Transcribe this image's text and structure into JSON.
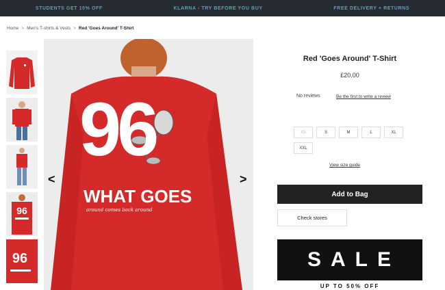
{
  "promo_bar": {
    "items": [
      "STUDENTS GET 10% OFF",
      "KLARNA - TRY BEFORE YOU BUY",
      "FREE DELIVERY + RETURNS"
    ]
  },
  "breadcrumb": {
    "home": "Home",
    "category": "Men's T-shirts & Vests",
    "current": "Red 'Goes Around' T-Shirt"
  },
  "product": {
    "title": "Red 'Goes Around' T-Shirt",
    "price": "£20.00",
    "reviews_text": "No reviews",
    "review_link": "Be the first to write a review",
    "sizes": [
      {
        "label": "XS",
        "available": false
      },
      {
        "label": "S",
        "available": true
      },
      {
        "label": "M",
        "available": true
      },
      {
        "label": "L",
        "available": true
      },
      {
        "label": "XL",
        "available": true
      },
      {
        "label": "XXL",
        "available": true
      }
    ],
    "size_guide": "View size guide",
    "add_to_bag": "Add to Bag",
    "check_stores": "Check stores"
  },
  "gallery": {
    "prev_arrow": "<",
    "next_arrow": ">",
    "shirt_number": "96",
    "shirt_text": "WHAT GOES",
    "shirt_script": "around comes back around"
  },
  "banner": {
    "title": "SALE",
    "subtitle": "UP TO 50% OFF"
  },
  "colors": {
    "promo_bg": "#262a31",
    "promo_text": "#4fa6c4",
    "shirt_red": "#d42a2a",
    "button_dark": "#222222"
  }
}
